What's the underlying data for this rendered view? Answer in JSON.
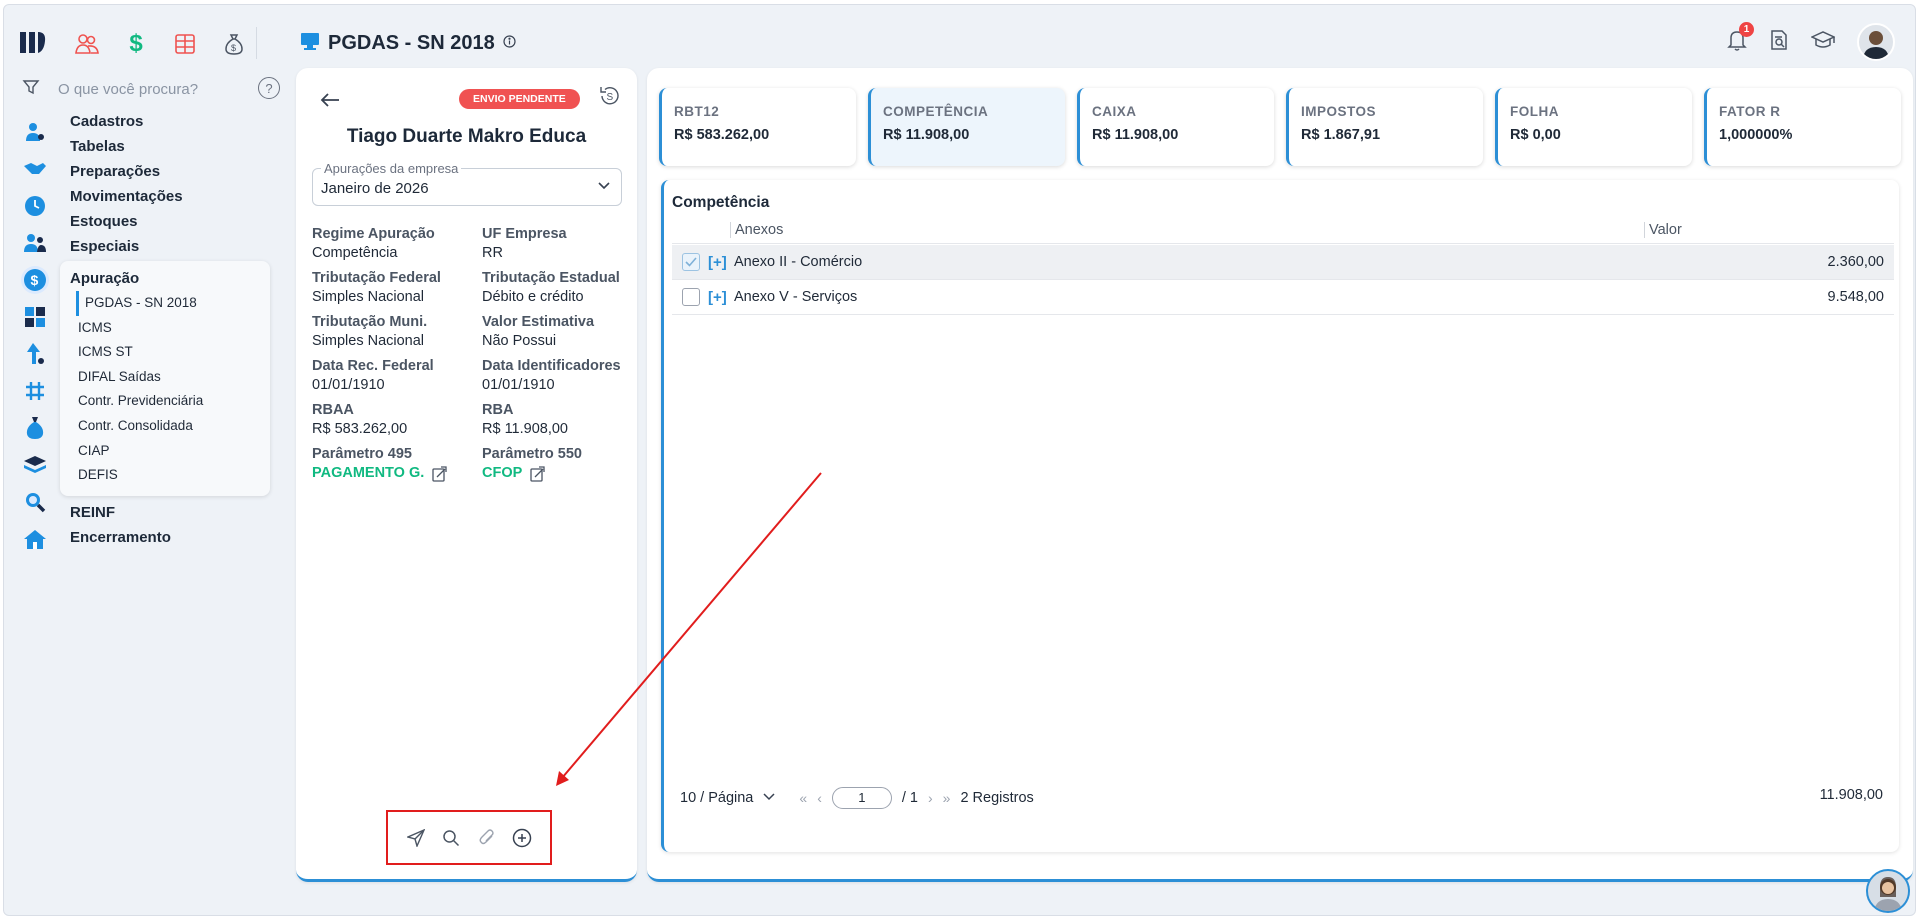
{
  "header": {
    "title": "PGDAS - SN 2018",
    "notifications_count": "1"
  },
  "sidebar": {
    "search_placeholder": "O que você procura?",
    "menu": [
      "Cadastros",
      "Tabelas",
      "Preparações",
      "Movimentações",
      "Estoques",
      "Especiais"
    ],
    "submenu_title": "Apuração",
    "submenu": [
      "PGDAS - SN 2018",
      "ICMS",
      "ICMS ST",
      "DIFAL Saídas",
      "Contr. Previdenciária",
      "Contr. Consolidada",
      "CIAP",
      "DEFIS"
    ],
    "menu_after": [
      "REINF",
      "Encerramento"
    ]
  },
  "detail": {
    "status": "ENVIO PENDENTE",
    "company": "Tiago Duarte Makro Educa",
    "select_label": "Apurações da empresa",
    "select_value": "Janeiro de 2026",
    "fields": [
      {
        "k": "Regime Apuração",
        "v": "Competência"
      },
      {
        "k": "UF Empresa",
        "v": "RR"
      },
      {
        "k": "Tributação Federal",
        "v": "Simples Nacional"
      },
      {
        "k": "Tributação Estadual",
        "v": "Débito e crédito"
      },
      {
        "k": "Tributação Muni.",
        "v": "Simples Nacional"
      },
      {
        "k": "Valor Estimativa",
        "v": "Não Possui"
      },
      {
        "k": "Data Rec. Federal",
        "v": "01/01/1910"
      },
      {
        "k": "Data Identificadores",
        "v": "01/01/1910"
      },
      {
        "k": "RBAA",
        "v": "R$ 583.262,00"
      },
      {
        "k": "RBA",
        "v": "R$ 11.908,00"
      },
      {
        "k": "Parâmetro 495",
        "v": "PAGAMENTO G."
      },
      {
        "k": "Parâmetro 550",
        "v": "CFOP"
      }
    ]
  },
  "cards": [
    {
      "k": "RBT12",
      "v": "R$ 583.262,00"
    },
    {
      "k": "COMPETÊNCIA",
      "v": "R$ 11.908,00"
    },
    {
      "k": "CAIXA",
      "v": "R$ 11.908,00"
    },
    {
      "k": "IMPOSTOS",
      "v": "R$ 1.867,91"
    },
    {
      "k": "FOLHA",
      "v": "R$ 0,00"
    },
    {
      "k": "FATOR R",
      "v": "1,000000%"
    }
  ],
  "table": {
    "title": "Competência",
    "col_anexos": "Anexos",
    "col_valor": "Valor",
    "rows": [
      {
        "name": "Anexo II - Comércio",
        "value": "2.360,00",
        "checked": true
      },
      {
        "name": "Anexo V - Serviços",
        "value": "9.548,00",
        "checked": false
      }
    ],
    "per_page": "10 / Página",
    "page": "1",
    "pages": "/ 1",
    "records": "2 Registros",
    "total": "11.908,00"
  }
}
